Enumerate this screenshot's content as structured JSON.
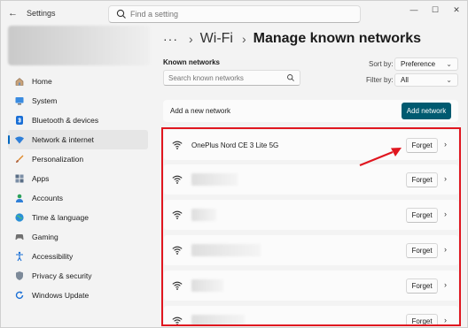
{
  "titlebar": {
    "app_title": "Settings",
    "search_placeholder": "Find a setting",
    "minimize": "—",
    "maximize": "☐",
    "close": "✕"
  },
  "sidebar": {
    "items": [
      {
        "label": "Home",
        "icon": "home-icon"
      },
      {
        "label": "System",
        "icon": "system-icon"
      },
      {
        "label": "Bluetooth & devices",
        "icon": "bluetooth-icon"
      },
      {
        "label": "Network & internet",
        "icon": "network-icon",
        "active": true
      },
      {
        "label": "Personalization",
        "icon": "brush-icon"
      },
      {
        "label": "Apps",
        "icon": "apps-icon"
      },
      {
        "label": "Accounts",
        "icon": "account-icon"
      },
      {
        "label": "Time & language",
        "icon": "globe-icon"
      },
      {
        "label": "Gaming",
        "icon": "gamepad-icon"
      },
      {
        "label": "Accessibility",
        "icon": "accessibility-icon"
      },
      {
        "label": "Privacy & security",
        "icon": "shield-icon"
      },
      {
        "label": "Windows Update",
        "icon": "update-icon"
      }
    ]
  },
  "breadcrumb": {
    "dots": "···",
    "sep1": "›",
    "parent": "Wi-Fi",
    "sep2": "›",
    "current": "Manage known networks"
  },
  "known": {
    "label": "Known networks",
    "search_placeholder": "Search known networks",
    "sort_label": "Sort by:",
    "sort_value": "Preference",
    "filter_label": "Filter by:",
    "filter_value": "All",
    "add_label": "Add a new network",
    "add_button": "Add network"
  },
  "networks": [
    {
      "name": "OnePlus Nord CE 3 Lite 5G",
      "forget": "Forget",
      "chevron": "›"
    },
    {
      "name": "",
      "forget": "Forget",
      "chevron": "›"
    },
    {
      "name": "",
      "forget": "Forget",
      "chevron": "›"
    },
    {
      "name": "",
      "forget": "Forget",
      "chevron": "›"
    },
    {
      "name": "",
      "forget": "Forget",
      "chevron": "›"
    },
    {
      "name": "",
      "forget": "Forget",
      "chevron": "›"
    }
  ],
  "colors": {
    "accent": "#0067c0",
    "add_button": "#005a70",
    "highlight": "#e0161f"
  }
}
